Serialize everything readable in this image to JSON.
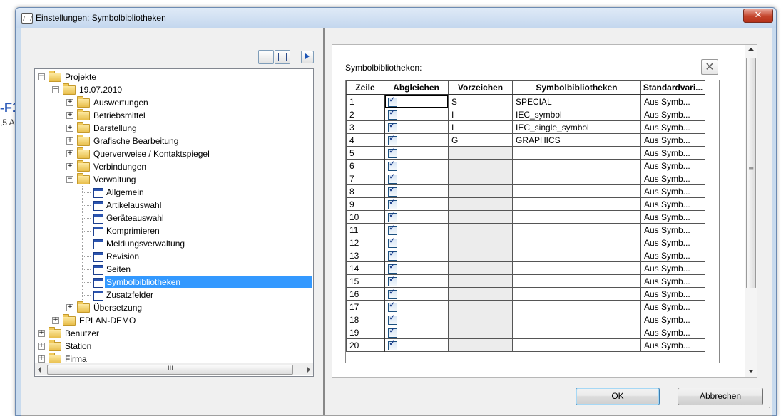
{
  "background": {
    "fragment1": "-F1",
    "fragment2": ",5 A"
  },
  "dialog": {
    "title": "Einstellungen: Symbolbibliotheken",
    "close_icon": "close-icon"
  },
  "toolbar": {
    "icons": [
      "collapse-panel-icon",
      "expand-panel-icon",
      "play-arrow-icon"
    ]
  },
  "tree": {
    "nodes": [
      {
        "label": "Projekte",
        "level": 0,
        "type": "folder",
        "expander": "−"
      },
      {
        "label": "19.07.2010",
        "level": 1,
        "type": "folder",
        "expander": "−"
      },
      {
        "label": "Auswertungen",
        "level": 2,
        "type": "folder",
        "expander": "+"
      },
      {
        "label": "Betriebsmittel",
        "level": 2,
        "type": "folder",
        "expander": "+"
      },
      {
        "label": "Darstellung",
        "level": 2,
        "type": "folder",
        "expander": "+"
      },
      {
        "label": "Grafische Bearbeitung",
        "level": 2,
        "type": "folder",
        "expander": "+"
      },
      {
        "label": "Querverweise / Kontaktspiegel",
        "level": 2,
        "type": "folder",
        "expander": "+"
      },
      {
        "label": "Verbindungen",
        "level": 2,
        "type": "folder",
        "expander": "+"
      },
      {
        "label": "Verwaltung",
        "level": 2,
        "type": "folder",
        "expander": "−"
      },
      {
        "label": "Allgemein",
        "level": 3,
        "type": "page"
      },
      {
        "label": "Artikelauswahl",
        "level": 3,
        "type": "page"
      },
      {
        "label": "Geräteauswahl",
        "level": 3,
        "type": "page"
      },
      {
        "label": "Komprimieren",
        "level": 3,
        "type": "page"
      },
      {
        "label": "Meldungsverwaltung",
        "level": 3,
        "type": "page"
      },
      {
        "label": "Revision",
        "level": 3,
        "type": "page"
      },
      {
        "label": "Seiten",
        "level": 3,
        "type": "page"
      },
      {
        "label": "Symbolbibliotheken",
        "level": 3,
        "type": "page",
        "selected": true
      },
      {
        "label": "Zusatzfelder",
        "level": 3,
        "type": "page"
      },
      {
        "label": "Übersetzung",
        "level": 2,
        "type": "folder",
        "expander": "+"
      },
      {
        "label": "EPLAN-DEMO",
        "level": 1,
        "type": "folder",
        "expander": "+"
      },
      {
        "label": "Benutzer",
        "level": 0,
        "type": "folder",
        "expander": "+"
      },
      {
        "label": "Station",
        "level": 0,
        "type": "folder",
        "expander": "+"
      },
      {
        "label": "Firma",
        "level": 0,
        "type": "folder",
        "expander": "+"
      }
    ],
    "hscroll_grip": "III"
  },
  "panel": {
    "label": "Symbolbibliotheken:",
    "clear_icon": "clear-x-icon",
    "columns": [
      "Zeile",
      "Abgleichen",
      "Vorzeichen",
      "Symbolbibliotheken",
      "Standardvari..."
    ],
    "rows": [
      {
        "zeile": "1",
        "checked": true,
        "vorzeichen": "S",
        "bibliothek": "SPECIAL",
        "standard": "Aus Symb..."
      },
      {
        "zeile": "2",
        "checked": true,
        "vorzeichen": "I",
        "bibliothek": "IEC_symbol",
        "standard": "Aus Symb..."
      },
      {
        "zeile": "3",
        "checked": true,
        "vorzeichen": "I",
        "bibliothek": "IEC_single_symbol",
        "standard": "Aus Symb..."
      },
      {
        "zeile": "4",
        "checked": true,
        "vorzeichen": "G",
        "bibliothek": "GRAPHICS",
        "standard": "Aus Symb..."
      },
      {
        "zeile": "5",
        "checked": true,
        "vorzeichen": "",
        "bibliothek": "",
        "standard": "Aus Symb..."
      },
      {
        "zeile": "6",
        "checked": true,
        "vorzeichen": "",
        "bibliothek": "",
        "standard": "Aus Symb..."
      },
      {
        "zeile": "7",
        "checked": true,
        "vorzeichen": "",
        "bibliothek": "",
        "standard": "Aus Symb..."
      },
      {
        "zeile": "8",
        "checked": true,
        "vorzeichen": "",
        "bibliothek": "",
        "standard": "Aus Symb..."
      },
      {
        "zeile": "9",
        "checked": true,
        "vorzeichen": "",
        "bibliothek": "",
        "standard": "Aus Symb..."
      },
      {
        "zeile": "10",
        "checked": true,
        "vorzeichen": "",
        "bibliothek": "",
        "standard": "Aus Symb..."
      },
      {
        "zeile": "11",
        "checked": true,
        "vorzeichen": "",
        "bibliothek": "",
        "standard": "Aus Symb..."
      },
      {
        "zeile": "12",
        "checked": true,
        "vorzeichen": "",
        "bibliothek": "",
        "standard": "Aus Symb..."
      },
      {
        "zeile": "13",
        "checked": true,
        "vorzeichen": "",
        "bibliothek": "",
        "standard": "Aus Symb..."
      },
      {
        "zeile": "14",
        "checked": true,
        "vorzeichen": "",
        "bibliothek": "",
        "standard": "Aus Symb..."
      },
      {
        "zeile": "15",
        "checked": true,
        "vorzeichen": "",
        "bibliothek": "",
        "standard": "Aus Symb..."
      },
      {
        "zeile": "16",
        "checked": true,
        "vorzeichen": "",
        "bibliothek": "",
        "standard": "Aus Symb..."
      },
      {
        "zeile": "17",
        "checked": true,
        "vorzeichen": "",
        "bibliothek": "",
        "standard": "Aus Symb..."
      },
      {
        "zeile": "18",
        "checked": true,
        "vorzeichen": "",
        "bibliothek": "",
        "standard": "Aus Symb..."
      },
      {
        "zeile": "19",
        "checked": true,
        "vorzeichen": "",
        "bibliothek": "",
        "standard": "Aus Symb..."
      },
      {
        "zeile": "20",
        "checked": true,
        "vorzeichen": "",
        "bibliothek": "",
        "standard": "Aus Symb..."
      }
    ],
    "vscroll_grip": "≡"
  },
  "buttons": {
    "ok": "OK",
    "cancel": "Abbrechen"
  },
  "colors": {
    "selection": "#3399ff",
    "close_button": "#c4432b"
  }
}
